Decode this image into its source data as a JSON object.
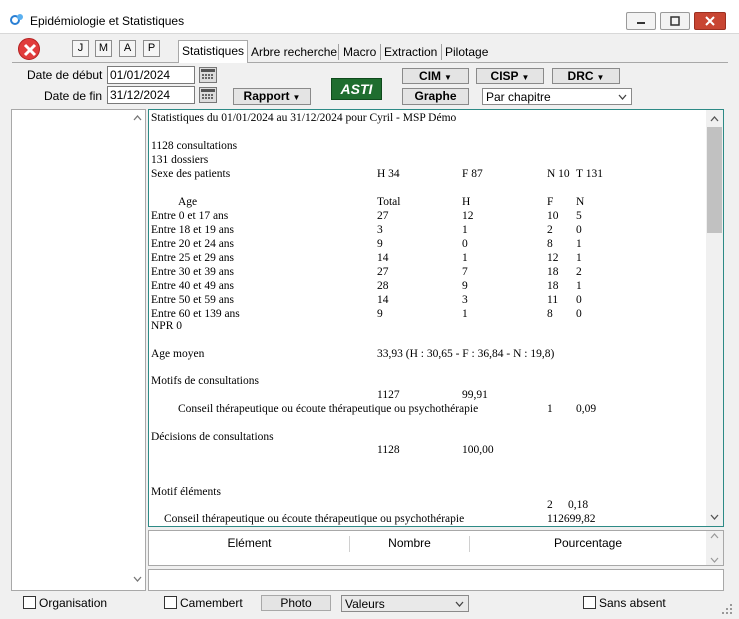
{
  "window": {
    "title": "Epidémiologie et Statistiques",
    "icon": "app-swirl-icon",
    "controls": [
      "minimize-icon",
      "maximize-icon",
      "close-icon"
    ]
  },
  "toolbar": {
    "close_icon": "red-close-icon",
    "period_buttons": [
      "J",
      "M",
      "A",
      "P"
    ]
  },
  "tabs": [
    {
      "label": "Statistiques",
      "active": true
    },
    {
      "label": "Arbre recherche",
      "active": false
    },
    {
      "label": "Macro",
      "active": false
    },
    {
      "label": "Extraction",
      "active": false
    },
    {
      "label": "Pilotage",
      "active": false
    }
  ],
  "dates": {
    "debut_label": "Date de début",
    "debut_value": "01/01/2024",
    "fin_label": "Date de fin",
    "fin_value": "31/12/2024",
    "calendar_icon": "calendar-icon"
  },
  "buttons": {
    "rapport": "Rapport",
    "asti": "ASTI",
    "cim": "CIM",
    "cisp": "CISP",
    "drc": "DRC",
    "graphe": "Graphe"
  },
  "chapitre_select": "Par chapitre",
  "report": {
    "heading": "Statistiques du 01/01/2024 au 31/12/2024 pour Cyril - MSP Démo",
    "consultations": "1128 consultations",
    "dossiers": "131 dossiers",
    "sexe": {
      "label": "Sexe des patients",
      "h": "H 34",
      "f": "F 87",
      "n": "N 10",
      "t": "T 131"
    },
    "age_header": {
      "label": "Age",
      "total": "Total",
      "h": "H",
      "f": "F",
      "n": "N"
    },
    "age_rows": [
      {
        "label": "Entre 0 et 17 ans",
        "total": "27",
        "h": "12",
        "f": "10",
        "n": "5"
      },
      {
        "label": "Entre 18 et 19 ans",
        "total": "3",
        "h": "1",
        "f": "2",
        "n": "0"
      },
      {
        "label": "Entre 20 et 24 ans",
        "total": "9",
        "h": "0",
        "f": "8",
        "n": "1"
      },
      {
        "label": "Entre 25 et 29 ans",
        "total": "14",
        "h": "1",
        "f": "12",
        "n": "1"
      },
      {
        "label": "Entre 30 et 39 ans",
        "total": "27",
        "h": "7",
        "f": "18",
        "n": "2"
      },
      {
        "label": "Entre 40 et 49 ans",
        "total": "28",
        "h": "9",
        "f": "18",
        "n": "1"
      },
      {
        "label": "Entre 50 et 59 ans",
        "total": "14",
        "h": "3",
        "f": "11",
        "n": "0"
      },
      {
        "label": "Entre 60 et 139 ans",
        "total": "9",
        "h": "1",
        "f": "8",
        "n": "0"
      }
    ],
    "npr": "NPR  0",
    "age_moyen_label": "Age moyen",
    "age_moyen_value": "33,93 (H : 30,65 - F : 36,84 - N : 19,8)",
    "motifs_label": "Motifs de consultations",
    "motifs_count": "1127",
    "motifs_pct": "99,91",
    "motif_item": {
      "label": "Conseil thérapeutique ou écoute thérapeutique ou psychothérapie",
      "count": "1",
      "pct": "0,09"
    },
    "decisions_label": "Décisions de consultations",
    "decisions_count": "1128",
    "decisions_pct": "100,00",
    "motif_elements_label": "Motif éléments",
    "elem_count": "2",
    "elem_pct": "0,18",
    "elem_item": {
      "label": "Conseil thérapeutique ou écoute thérapeutique ou psychothérapie",
      "value": "112699,82"
    }
  },
  "table": {
    "columns": [
      "Elément",
      "Nombre",
      "Pourcentage"
    ]
  },
  "footer": {
    "organisation": "Organisation",
    "camembert": "Camembert",
    "photo": "Photo",
    "valeurs": "Valeurs",
    "sans_absent": "Sans absent"
  }
}
